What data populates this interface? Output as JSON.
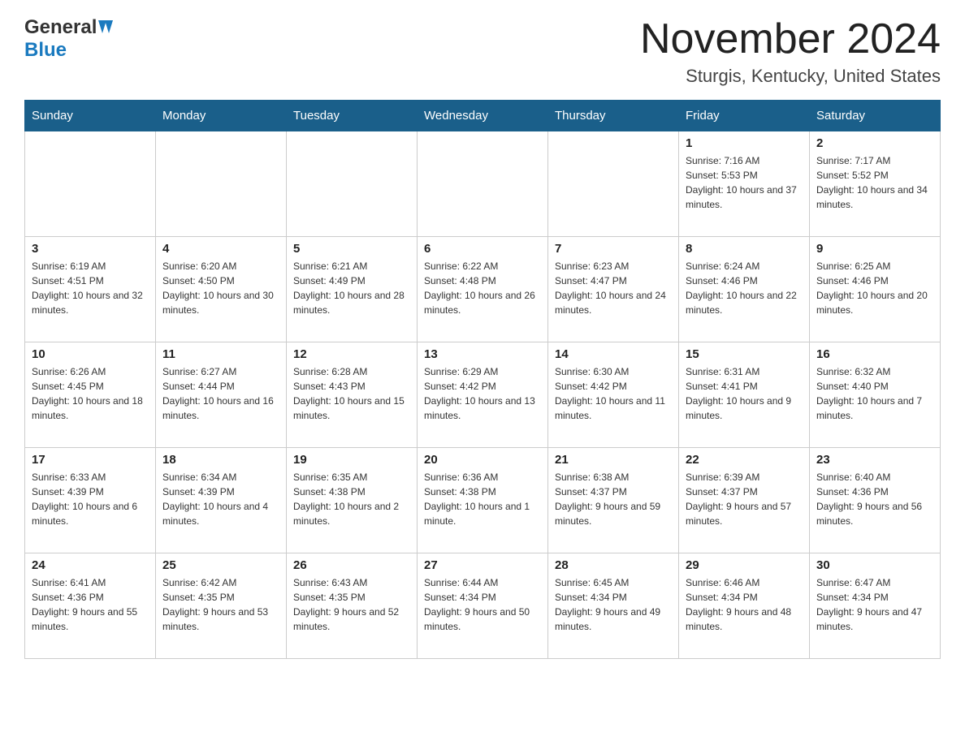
{
  "logo": {
    "text_general": "General",
    "text_blue": "Blue"
  },
  "header": {
    "month": "November 2024",
    "location": "Sturgis, Kentucky, United States"
  },
  "weekdays": [
    "Sunday",
    "Monday",
    "Tuesday",
    "Wednesday",
    "Thursday",
    "Friday",
    "Saturday"
  ],
  "weeks": [
    [
      {
        "day": "",
        "sunrise": "",
        "sunset": "",
        "daylight": ""
      },
      {
        "day": "",
        "sunrise": "",
        "sunset": "",
        "daylight": ""
      },
      {
        "day": "",
        "sunrise": "",
        "sunset": "",
        "daylight": ""
      },
      {
        "day": "",
        "sunrise": "",
        "sunset": "",
        "daylight": ""
      },
      {
        "day": "",
        "sunrise": "",
        "sunset": "",
        "daylight": ""
      },
      {
        "day": "1",
        "sunrise": "Sunrise: 7:16 AM",
        "sunset": "Sunset: 5:53 PM",
        "daylight": "Daylight: 10 hours and 37 minutes."
      },
      {
        "day": "2",
        "sunrise": "Sunrise: 7:17 AM",
        "sunset": "Sunset: 5:52 PM",
        "daylight": "Daylight: 10 hours and 34 minutes."
      }
    ],
    [
      {
        "day": "3",
        "sunrise": "Sunrise: 6:19 AM",
        "sunset": "Sunset: 4:51 PM",
        "daylight": "Daylight: 10 hours and 32 minutes."
      },
      {
        "day": "4",
        "sunrise": "Sunrise: 6:20 AM",
        "sunset": "Sunset: 4:50 PM",
        "daylight": "Daylight: 10 hours and 30 minutes."
      },
      {
        "day": "5",
        "sunrise": "Sunrise: 6:21 AM",
        "sunset": "Sunset: 4:49 PM",
        "daylight": "Daylight: 10 hours and 28 minutes."
      },
      {
        "day": "6",
        "sunrise": "Sunrise: 6:22 AM",
        "sunset": "Sunset: 4:48 PM",
        "daylight": "Daylight: 10 hours and 26 minutes."
      },
      {
        "day": "7",
        "sunrise": "Sunrise: 6:23 AM",
        "sunset": "Sunset: 4:47 PM",
        "daylight": "Daylight: 10 hours and 24 minutes."
      },
      {
        "day": "8",
        "sunrise": "Sunrise: 6:24 AM",
        "sunset": "Sunset: 4:46 PM",
        "daylight": "Daylight: 10 hours and 22 minutes."
      },
      {
        "day": "9",
        "sunrise": "Sunrise: 6:25 AM",
        "sunset": "Sunset: 4:46 PM",
        "daylight": "Daylight: 10 hours and 20 minutes."
      }
    ],
    [
      {
        "day": "10",
        "sunrise": "Sunrise: 6:26 AM",
        "sunset": "Sunset: 4:45 PM",
        "daylight": "Daylight: 10 hours and 18 minutes."
      },
      {
        "day": "11",
        "sunrise": "Sunrise: 6:27 AM",
        "sunset": "Sunset: 4:44 PM",
        "daylight": "Daylight: 10 hours and 16 minutes."
      },
      {
        "day": "12",
        "sunrise": "Sunrise: 6:28 AM",
        "sunset": "Sunset: 4:43 PM",
        "daylight": "Daylight: 10 hours and 15 minutes."
      },
      {
        "day": "13",
        "sunrise": "Sunrise: 6:29 AM",
        "sunset": "Sunset: 4:42 PM",
        "daylight": "Daylight: 10 hours and 13 minutes."
      },
      {
        "day": "14",
        "sunrise": "Sunrise: 6:30 AM",
        "sunset": "Sunset: 4:42 PM",
        "daylight": "Daylight: 10 hours and 11 minutes."
      },
      {
        "day": "15",
        "sunrise": "Sunrise: 6:31 AM",
        "sunset": "Sunset: 4:41 PM",
        "daylight": "Daylight: 10 hours and 9 minutes."
      },
      {
        "day": "16",
        "sunrise": "Sunrise: 6:32 AM",
        "sunset": "Sunset: 4:40 PM",
        "daylight": "Daylight: 10 hours and 7 minutes."
      }
    ],
    [
      {
        "day": "17",
        "sunrise": "Sunrise: 6:33 AM",
        "sunset": "Sunset: 4:39 PM",
        "daylight": "Daylight: 10 hours and 6 minutes."
      },
      {
        "day": "18",
        "sunrise": "Sunrise: 6:34 AM",
        "sunset": "Sunset: 4:39 PM",
        "daylight": "Daylight: 10 hours and 4 minutes."
      },
      {
        "day": "19",
        "sunrise": "Sunrise: 6:35 AM",
        "sunset": "Sunset: 4:38 PM",
        "daylight": "Daylight: 10 hours and 2 minutes."
      },
      {
        "day": "20",
        "sunrise": "Sunrise: 6:36 AM",
        "sunset": "Sunset: 4:38 PM",
        "daylight": "Daylight: 10 hours and 1 minute."
      },
      {
        "day": "21",
        "sunrise": "Sunrise: 6:38 AM",
        "sunset": "Sunset: 4:37 PM",
        "daylight": "Daylight: 9 hours and 59 minutes."
      },
      {
        "day": "22",
        "sunrise": "Sunrise: 6:39 AM",
        "sunset": "Sunset: 4:37 PM",
        "daylight": "Daylight: 9 hours and 57 minutes."
      },
      {
        "day": "23",
        "sunrise": "Sunrise: 6:40 AM",
        "sunset": "Sunset: 4:36 PM",
        "daylight": "Daylight: 9 hours and 56 minutes."
      }
    ],
    [
      {
        "day": "24",
        "sunrise": "Sunrise: 6:41 AM",
        "sunset": "Sunset: 4:36 PM",
        "daylight": "Daylight: 9 hours and 55 minutes."
      },
      {
        "day": "25",
        "sunrise": "Sunrise: 6:42 AM",
        "sunset": "Sunset: 4:35 PM",
        "daylight": "Daylight: 9 hours and 53 minutes."
      },
      {
        "day": "26",
        "sunrise": "Sunrise: 6:43 AM",
        "sunset": "Sunset: 4:35 PM",
        "daylight": "Daylight: 9 hours and 52 minutes."
      },
      {
        "day": "27",
        "sunrise": "Sunrise: 6:44 AM",
        "sunset": "Sunset: 4:34 PM",
        "daylight": "Daylight: 9 hours and 50 minutes."
      },
      {
        "day": "28",
        "sunrise": "Sunrise: 6:45 AM",
        "sunset": "Sunset: 4:34 PM",
        "daylight": "Daylight: 9 hours and 49 minutes."
      },
      {
        "day": "29",
        "sunrise": "Sunrise: 6:46 AM",
        "sunset": "Sunset: 4:34 PM",
        "daylight": "Daylight: 9 hours and 48 minutes."
      },
      {
        "day": "30",
        "sunrise": "Sunrise: 6:47 AM",
        "sunset": "Sunset: 4:34 PM",
        "daylight": "Daylight: 9 hours and 47 minutes."
      }
    ]
  ]
}
